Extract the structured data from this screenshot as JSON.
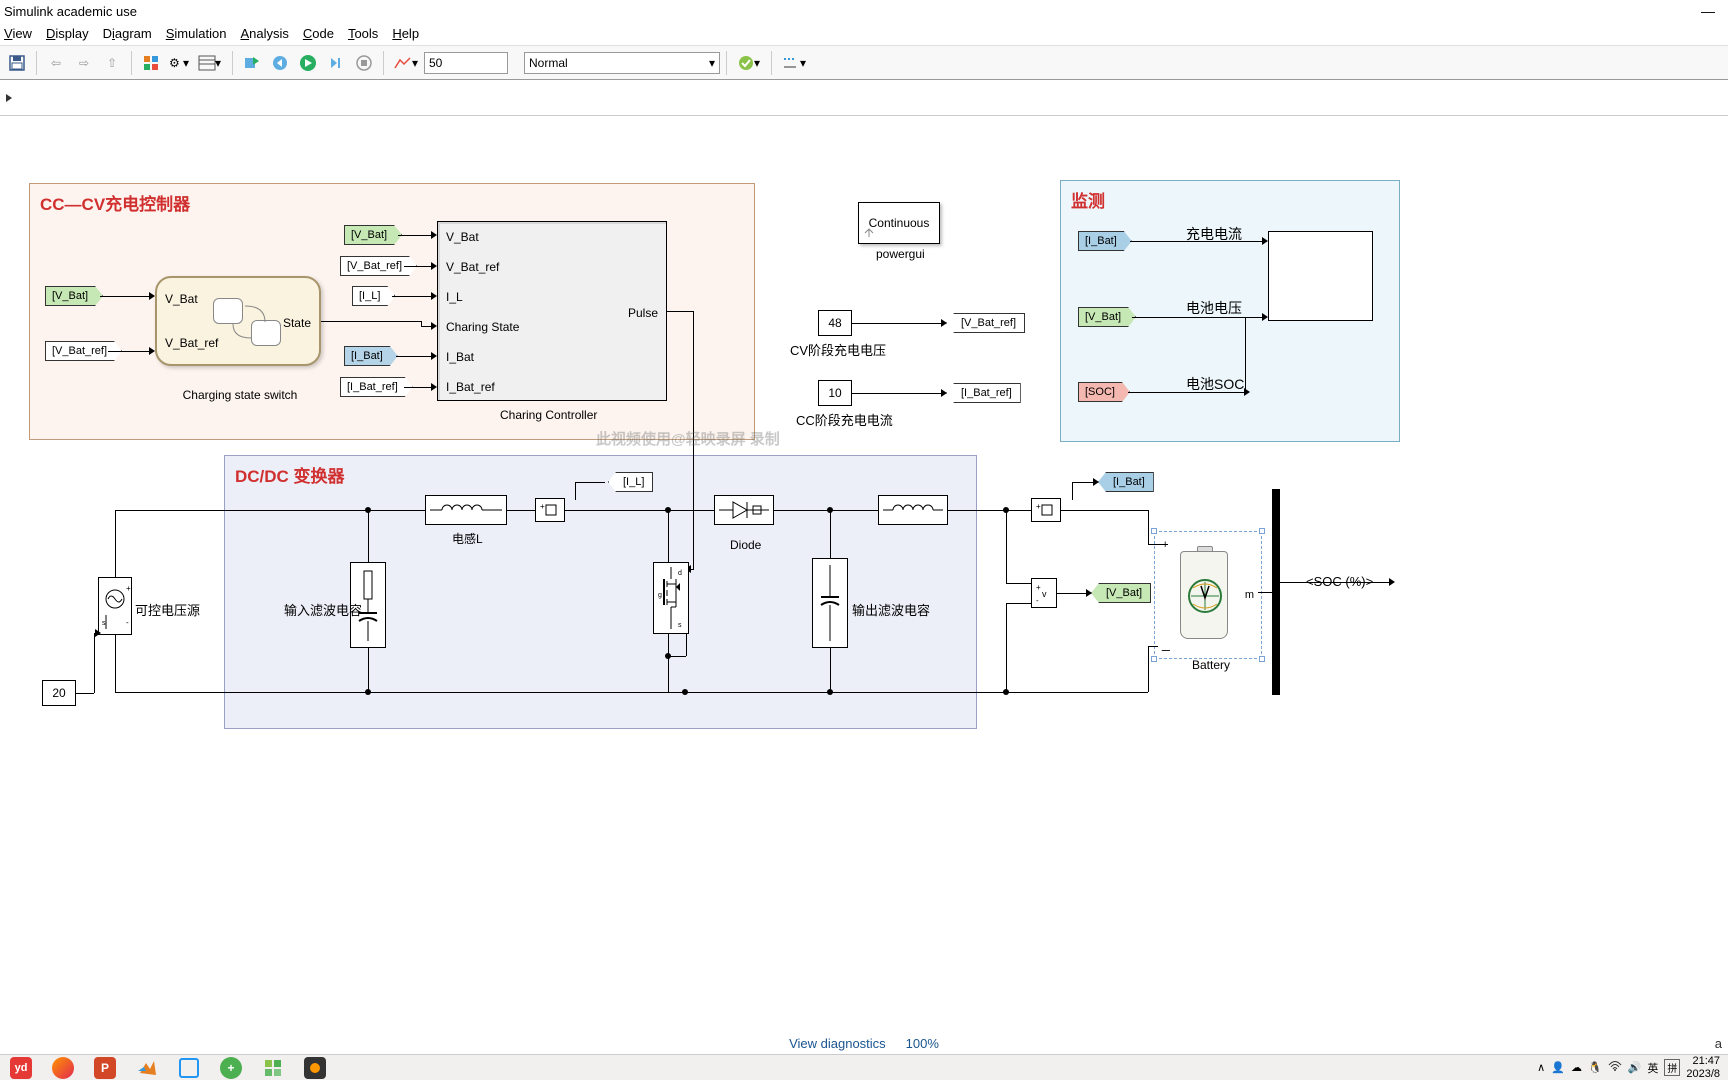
{
  "window": {
    "title": "Simulink academic use"
  },
  "menu": {
    "view": "View",
    "display": "Display",
    "diagram": "Diagram",
    "simulation": "Simulation",
    "analysis": "Analysis",
    "code": "Code",
    "tools": "Tools",
    "help": "Help"
  },
  "toolbar": {
    "stopTime": "50",
    "mode": "Normal"
  },
  "regions": {
    "cc": "CC—CV充电控制器",
    "dc": "DC/DC 变换器",
    "mon": "监测"
  },
  "blocks": {
    "stateflow": {
      "ports": {
        "in1": "V_Bat",
        "in2": "V_Bat_ref",
        "out": "State"
      },
      "label": "Charging state switch"
    },
    "controller": {
      "ports": {
        "in1": "V_Bat",
        "in2": "V_Bat_ref",
        "in3": "I_L",
        "in4": "Charing State",
        "in5": "I_Bat",
        "in6": "I_Bat_ref",
        "out": "Pulse"
      },
      "label": "Charing Controller"
    },
    "powergui": {
      "text": "Continuous",
      "label": "powergui"
    },
    "inductor": "电感L",
    "diode": "Diode",
    "capIn": "输入滤波电容",
    "capOut": "输出滤波电容",
    "source": "可控电压源",
    "battery": "Battery",
    "socOut": "<SOC (%)>"
  },
  "constants": {
    "c48": "48",
    "c10": "10",
    "c20": "20"
  },
  "labels": {
    "cv": "CV阶段充电电压",
    "cc": "CC阶段充电电流",
    "monI": "充电电流",
    "monV": "电池电压",
    "monSOC": "电池SOC"
  },
  "tags": {
    "vbat": "[V_Bat]",
    "vbatref": "[V_Bat_ref]",
    "il": "[I_L]",
    "ibat": "[I_Bat]",
    "ibatref": "[I_Bat_ref]",
    "soc": "[SOC]"
  },
  "watermark": "此视频使用@轻映录屏 录制",
  "status": {
    "diag": "View diagnostics",
    "zoom": "100%"
  },
  "taskbar": {
    "ime1": "英",
    "ime2": "拼",
    "time": "21:47",
    "date": "2023/8"
  }
}
